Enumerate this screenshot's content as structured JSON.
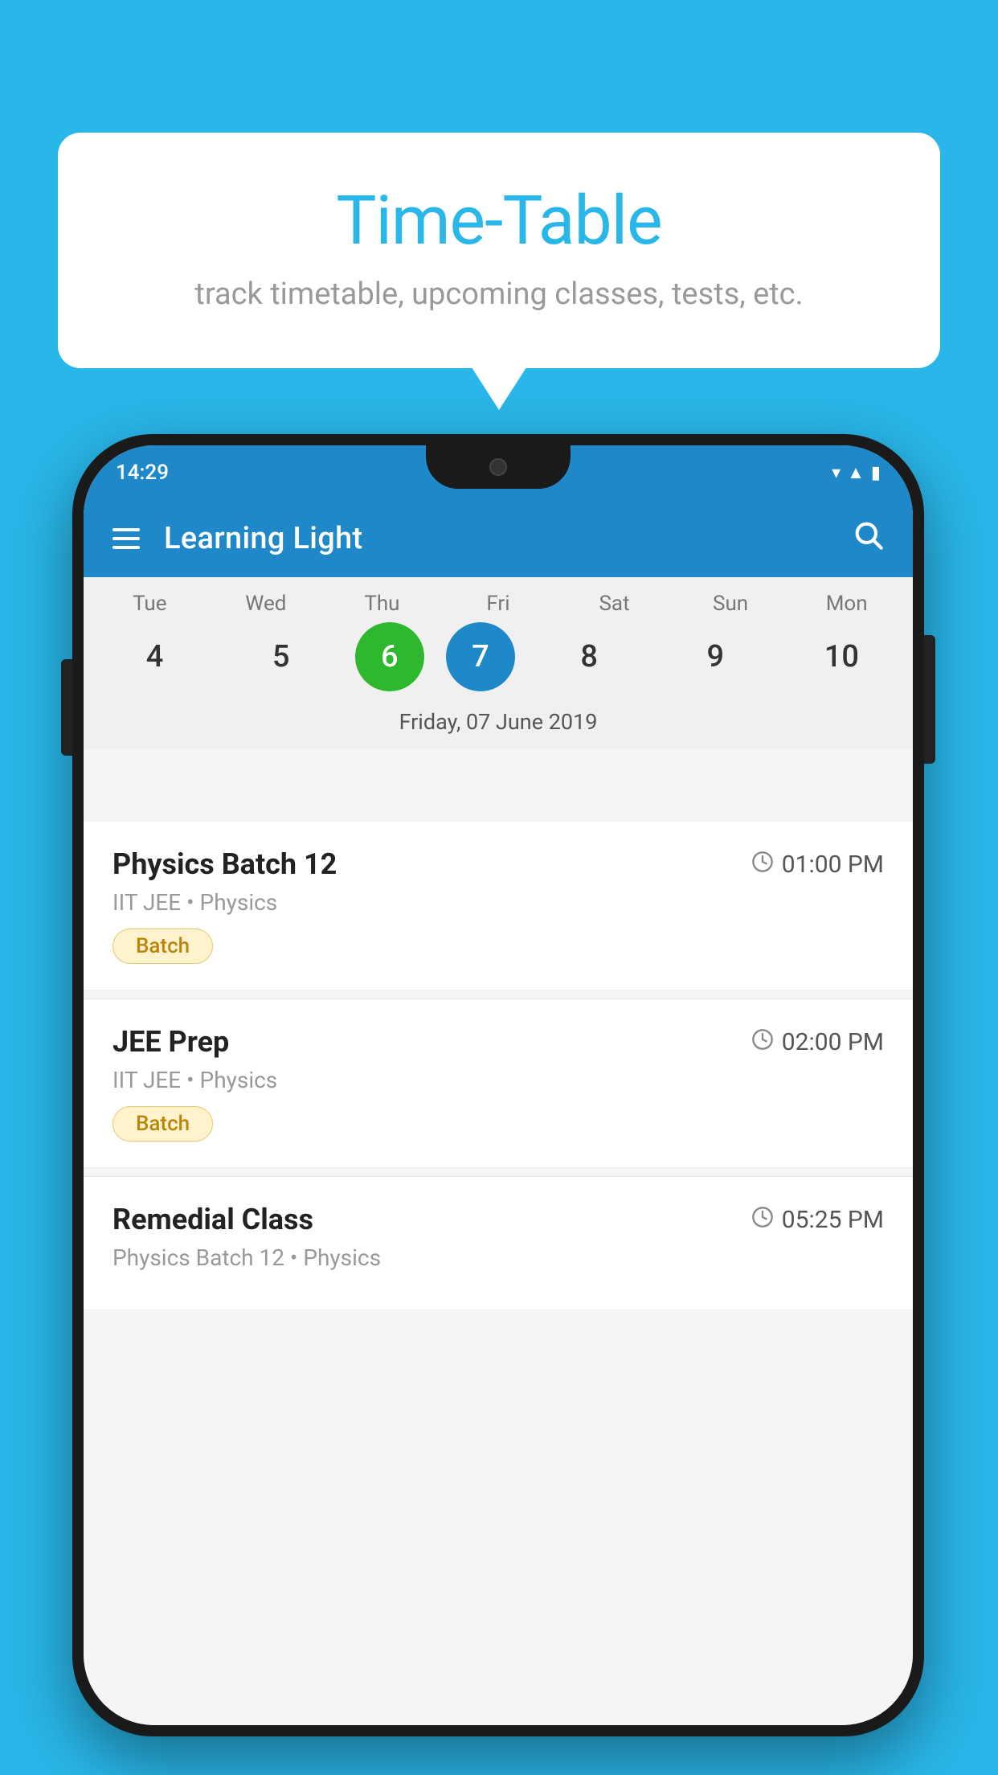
{
  "background_color": "#29B6E8",
  "tooltip": {
    "title": "Time-Table",
    "subtitle": "track timetable, upcoming classes, tests, etc."
  },
  "phone": {
    "status_time": "14:29",
    "app_title": "Learning Light",
    "calendar": {
      "days": [
        "Tue",
        "Wed",
        "Thu",
        "Fri",
        "Sat",
        "Sun",
        "Mon"
      ],
      "dates": [
        4,
        5,
        6,
        7,
        8,
        9,
        10
      ],
      "today_index": 2,
      "selected_index": 3,
      "selected_label": "Friday, 07 June 2019"
    },
    "events": [
      {
        "name": "Physics Batch 12",
        "time": "01:00 PM",
        "category": "IIT JEE • Physics",
        "badge": "Batch"
      },
      {
        "name": "JEE Prep",
        "time": "02:00 PM",
        "category": "IIT JEE • Physics",
        "badge": "Batch"
      },
      {
        "name": "Remedial Class",
        "time": "05:25 PM",
        "category": "Physics Batch 12 • Physics",
        "badge": null
      }
    ]
  },
  "buttons": {
    "menu_label": "☰",
    "search_label": "🔍"
  }
}
